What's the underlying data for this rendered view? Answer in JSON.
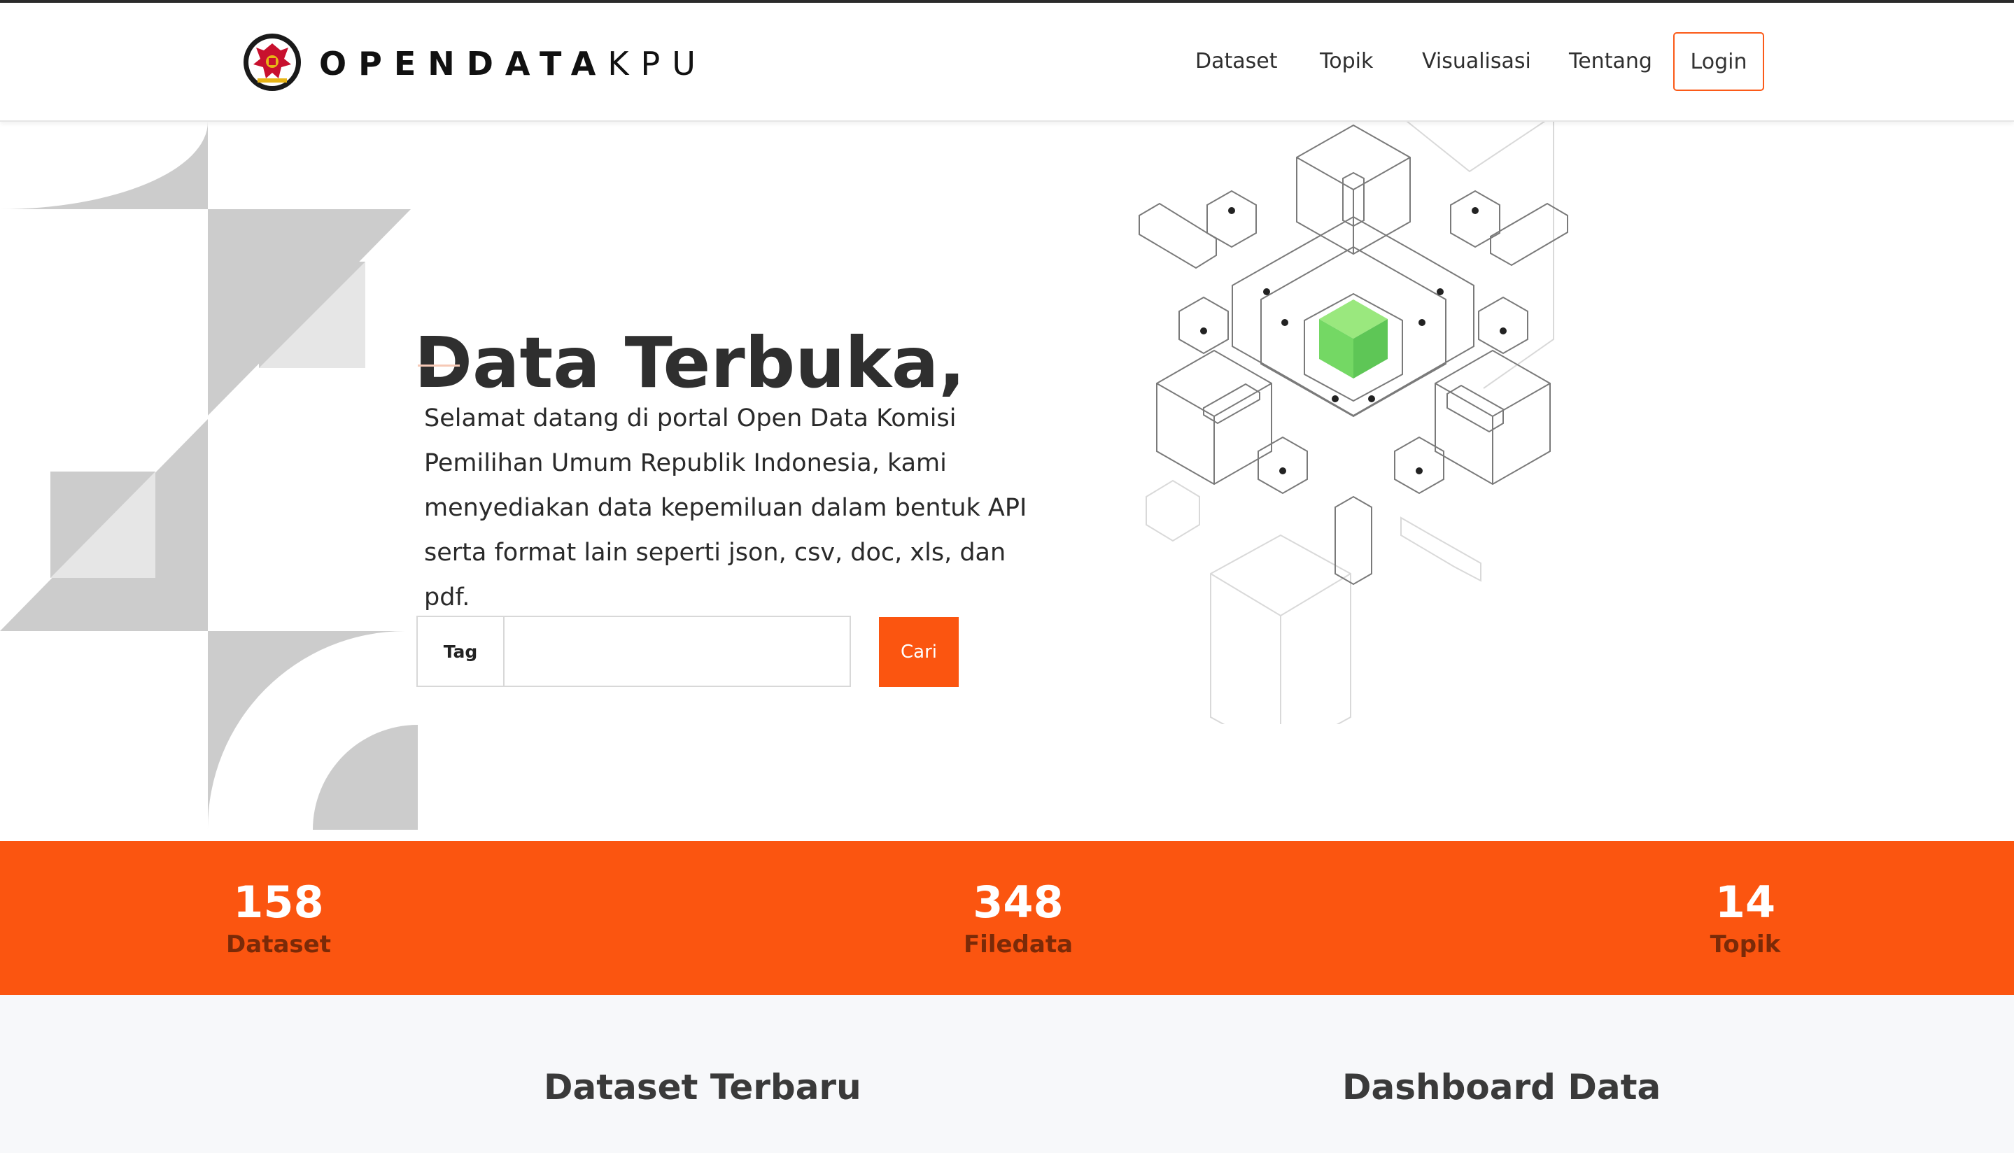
{
  "brand": {
    "bold": "OPENDATA",
    "light": "KPU"
  },
  "nav": {
    "items": [
      "Dataset",
      "Topik",
      "Visualisasi",
      "Tentang"
    ],
    "login": "Login"
  },
  "hero": {
    "title": "Data Terbuka,",
    "description": "Selamat datang di portal Open Data Komisi Pemilihan Umum Republik Indonesia, kami menyediakan data kepemiluan dalam bentuk API serta format lain seperti json, csv, doc, xls, dan pdf.",
    "search": {
      "tag_label": "Tag",
      "value": "",
      "placeholder": "",
      "button": "Cari"
    }
  },
  "stats": [
    {
      "value": "158",
      "label": "Dataset"
    },
    {
      "value": "348",
      "label": "Filedata"
    },
    {
      "value": "14",
      "label": "Topik"
    }
  ],
  "sections": {
    "latest": "Dataset Terbaru",
    "dashboard": "Dashboard Data"
  },
  "colors": {
    "accent": "#fb5510",
    "accent_dark": "#7a2a08",
    "green_cube": "#6fd85f"
  },
  "icons": {
    "logo": "kpu-garuda-emblem-icon"
  }
}
